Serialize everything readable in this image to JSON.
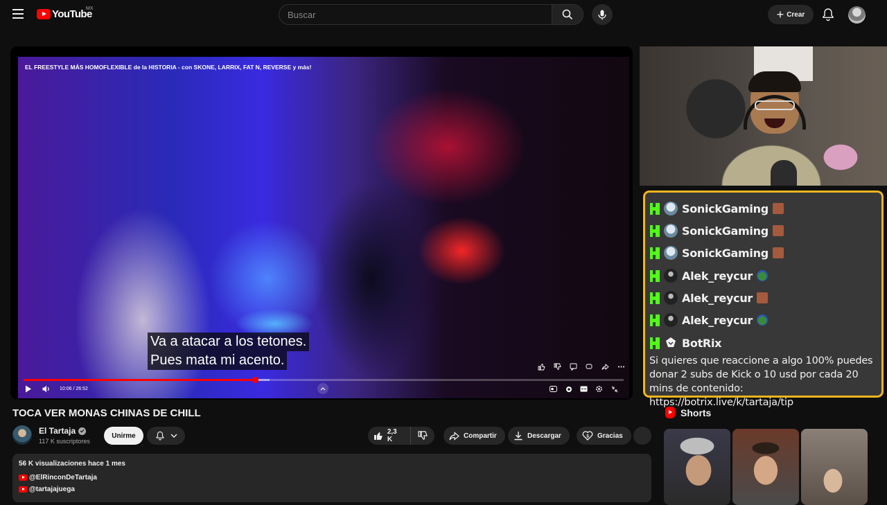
{
  "header": {
    "logo_text": "YouTube",
    "country_code": "MX",
    "search_placeholder": "Buscar",
    "create_label": "Crear"
  },
  "player": {
    "video_title_overlay": "EL FREESTYLE MÁS HOMOFLEXIBLE de la HISTORIA - con SKONE, LARRIX, FAT N, REVERSE y más!",
    "subtitle_line_1": "Va a atacar a los tetones.",
    "subtitle_line_2": "Pues mata mi acento.",
    "time_display": "10:06 / 26:52",
    "progress_played_fraction": 0.386,
    "progress_loaded_fraction": 0.41
  },
  "video": {
    "title": "TOCA VER MONAS CHINAS DE CHILL",
    "channel_name": "El Tartaja",
    "subscribers": "117 K suscriptores",
    "join_label": "Unirme",
    "likes": "2,3 K",
    "share_label": "Compartir",
    "download_label": "Descargar",
    "thanks_label": "Gracias"
  },
  "description": {
    "stats": "56 K visualizaciones  hace 1 mes",
    "links": [
      "@ElRinconDeTartaja",
      "@tartajajuega"
    ]
  },
  "chat": {
    "messages": [
      {
        "user": "SonickGaming",
        "emote": "emote-face-icon"
      },
      {
        "user": "SonickGaming",
        "emote": "emote-face-icon"
      },
      {
        "user": "SonickGaming",
        "emote": "emote-face-icon"
      },
      {
        "user": "Alek_reycur",
        "emote": "emote-pepe-icon"
      },
      {
        "user": "Alek_reycur",
        "emote": "emote-face-icon"
      },
      {
        "user": "Alek_reycur",
        "emote": "emote-pepe-icon"
      },
      {
        "user": "BotRix",
        "emote": ""
      }
    ],
    "bot_message": "Si quieres que reaccione a algo 100% puedes donar 2 subs de Kick o 10 usd por cada 20 mins de contenido: https://botrix.live/k/tartaja/tip"
  },
  "shorts": {
    "heading": "Shorts"
  },
  "colors": {
    "accent_red": "#ff0000",
    "chat_border": "#f2b520",
    "kick_green": "#53fc18",
    "background": "#0f0f0f"
  }
}
